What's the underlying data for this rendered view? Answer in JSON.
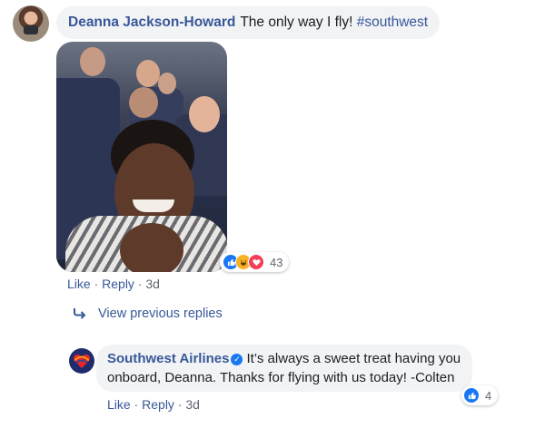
{
  "comment": {
    "author": "Deanna Jackson-Howard",
    "text": "The only way I fly!",
    "hashtag": "#southwest",
    "reaction_count": "43",
    "actions": {
      "like": "Like",
      "reply": "Reply",
      "time": "3d",
      "sep": " · "
    }
  },
  "view_previous": "View previous replies",
  "reply": {
    "author": "Southwest Airlines",
    "text": "It’s always a sweet treat having you onboard, Deanna. Thanks for flying with us today! -Colten",
    "reaction_count": "4",
    "actions": {
      "like": "Like",
      "reply": "Reply",
      "time": "3d",
      "sep": " · "
    }
  },
  "icons": {
    "like": "thumbs-up-icon",
    "haha": "laughing-face-icon",
    "love": "heart-icon",
    "verified": "verified-badge-icon",
    "reply_arrow": "reply-arrow-icon"
  },
  "colors": {
    "link": "#385898",
    "bubble": "#f2f3f5",
    "like": "#1877f2",
    "love": "#f33e58",
    "haha": "#f7b125",
    "muted": "#606770"
  }
}
